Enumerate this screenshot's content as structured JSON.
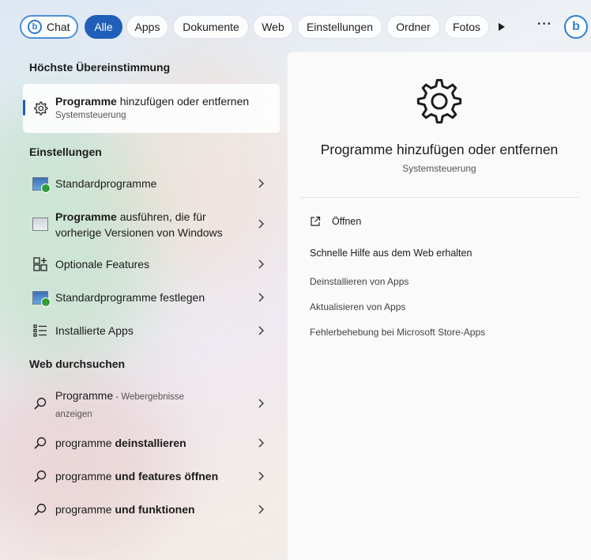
{
  "filters": {
    "chat": "Chat",
    "all": "Alle",
    "apps": "Apps",
    "documents": "Dokumente",
    "web": "Web",
    "settings": "Einstellungen",
    "folders": "Ordner",
    "photos": "Fotos",
    "more": "···"
  },
  "left": {
    "best_match_heading": "Höchste Übereinstimmung",
    "best_match": {
      "title_bold": "Programme",
      "title_rest": " hinzufügen oder entfernen",
      "subtitle": "Systemsteuerung",
      "icon": "gear-icon"
    },
    "settings_heading": "Einstellungen",
    "settings_items": [
      {
        "label": "Standardprogramme",
        "icon": "default-apps-icon"
      },
      {
        "label_bold": "Programme",
        "label_rest": " ausführen, die für",
        "label_line2": "vorherige Versionen von Windows",
        "icon": "compatibility-icon"
      },
      {
        "label": "Optionale Features",
        "icon": "optional-features-icon"
      },
      {
        "label": "Standardprogramme festlegen",
        "icon": "default-apps-icon"
      },
      {
        "label": "Installierte Apps",
        "icon": "installed-apps-icon"
      }
    ],
    "web_heading": "Web durchsuchen",
    "web_items": [
      {
        "label": "Programme",
        "note": " - Webergebnisse",
        "note_line2": "anzeigen"
      },
      {
        "label_plain": "programme ",
        "label_bold": "deinstallieren"
      },
      {
        "label_plain": "programme ",
        "label_bold": "und features öffnen"
      },
      {
        "label_plain": "programme ",
        "label_bold": "und funktionen"
      }
    ]
  },
  "right": {
    "title": "Programme hinzufügen oder entfernen",
    "subtitle": "Systemsteuerung",
    "open_label": "Öffnen",
    "help_heading": "Schnelle Hilfe aus dem Web erhalten",
    "help_links": [
      "Deinstallieren von Apps",
      "Aktualisieren von Apps",
      "Fehlerbehebung bei Microsoft Store-Apps"
    ]
  },
  "colors": {
    "accent": "#1f5fb9",
    "chat_border": "#4d8fd9",
    "bing_blue": "#2f7fd4"
  }
}
